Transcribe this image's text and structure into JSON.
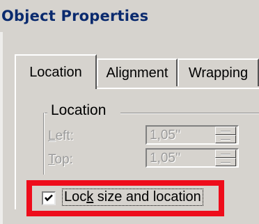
{
  "dialog": {
    "title": "Object Properties"
  },
  "tabs": [
    {
      "label": "Location",
      "active": true
    },
    {
      "label": "Alignment",
      "active": false
    },
    {
      "label": "Wrapping",
      "active": false
    }
  ],
  "location_group": {
    "label": "Location",
    "left": {
      "label_mnemonic": "L",
      "label_rest": "eft:",
      "value": "1,05''",
      "enabled": false
    },
    "top": {
      "label_mnemonic": "T",
      "label_rest": "op:",
      "value": "1,05''",
      "enabled": false
    }
  },
  "lock_checkbox": {
    "label_before": "Loc",
    "label_mnemonic": "k",
    "label_after": " size and location",
    "checked": true
  },
  "colors": {
    "dialog_face": "#d6d3ce",
    "title_text": "#0a2a6e",
    "highlight_border": "#ee0c1b",
    "disabled_text": "#9a9a9a"
  },
  "icons": {
    "checkmark": "check-icon",
    "spin_up": "spin-up-icon",
    "spin_down": "spin-down-icon"
  }
}
